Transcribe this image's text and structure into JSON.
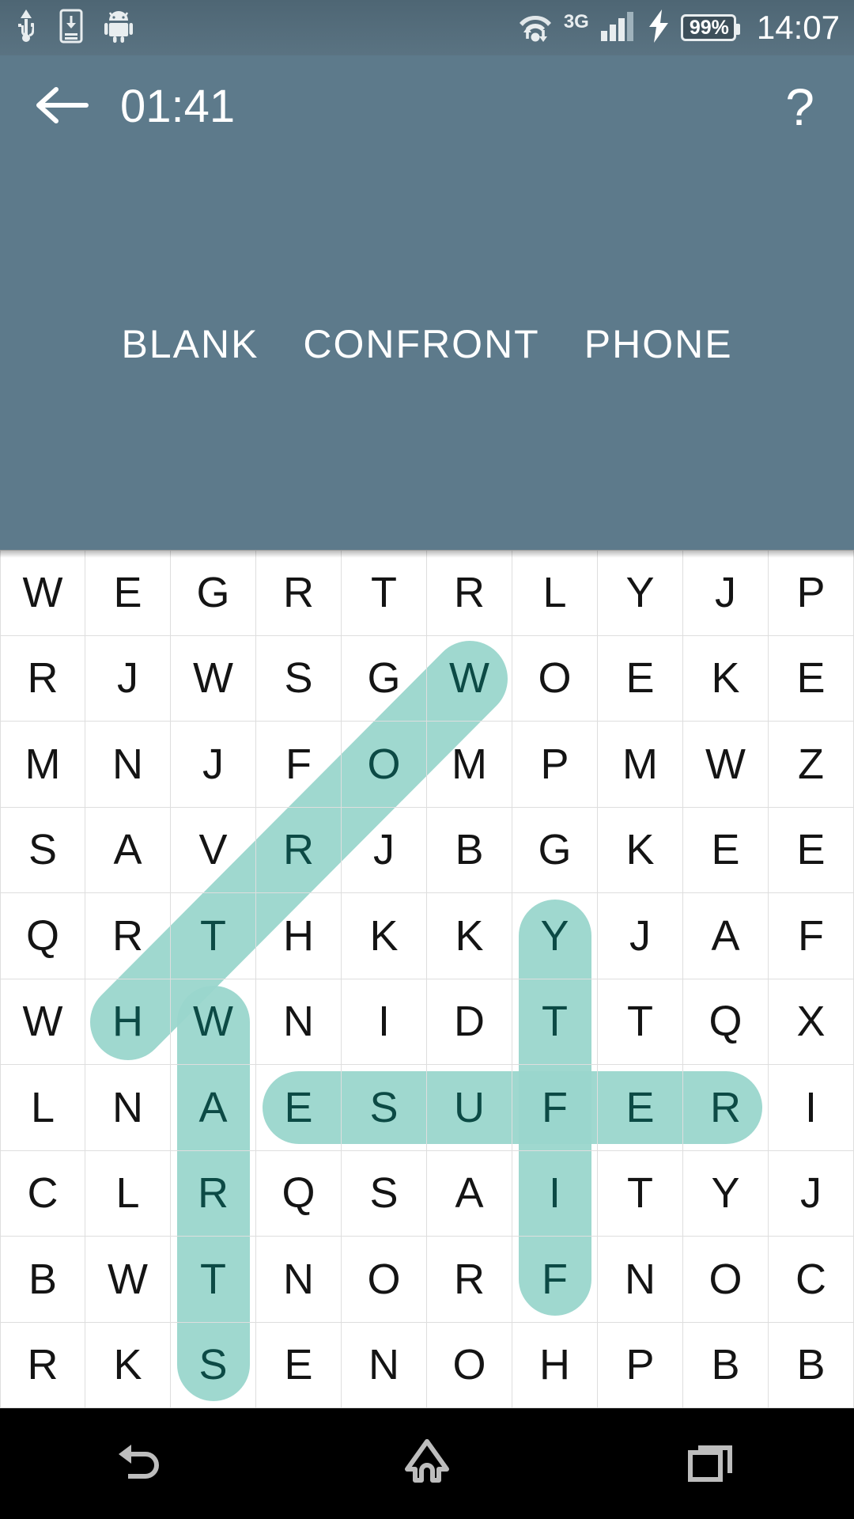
{
  "status_bar": {
    "icons": [
      "usb-icon",
      "sd-card-download-icon",
      "android-robot-icon"
    ],
    "network_label": "3G",
    "battery_percent": "99%",
    "clock": "14:07",
    "wifi_icon": "wifi-data-transfer-icon",
    "signal_icon": "cellular-signal-icon",
    "charging_icon": "lightning-bolt-icon"
  },
  "toolbar": {
    "back_icon": "back-arrow-icon",
    "timer": "01:41",
    "help_label": "?"
  },
  "word_list": {
    "words": [
      {
        "text": "BLANK",
        "found": false
      },
      {
        "text": "CONFRONT",
        "found": false
      },
      {
        "text": "PHONE",
        "found": false
      }
    ]
  },
  "colors": {
    "header_bg": "#5d7a8b",
    "status_bg": "#526b79",
    "grid_bg": "#ffffff",
    "grid_line": "#dedede",
    "letter": "#141414",
    "highlight": "#9ad6cd",
    "highlight_letter": "#0c4a45",
    "nav_bg": "#000000",
    "nav_icon": "#bdbdbd"
  },
  "grid": {
    "rows": 10,
    "cols": 10,
    "letters": [
      [
        "W",
        "E",
        "G",
        "R",
        "T",
        "R",
        "L",
        "Y",
        "J",
        "P"
      ],
      [
        "R",
        "J",
        "W",
        "S",
        "G",
        "W",
        "O",
        "E",
        "K",
        "E"
      ],
      [
        "M",
        "N",
        "J",
        "F",
        "O",
        "M",
        "P",
        "M",
        "W",
        "Z"
      ],
      [
        "S",
        "A",
        "V",
        "R",
        "J",
        "B",
        "G",
        "K",
        "E",
        "E"
      ],
      [
        "Q",
        "R",
        "T",
        "H",
        "K",
        "K",
        "Y",
        "J",
        "A",
        "F"
      ],
      [
        "W",
        "H",
        "W",
        "N",
        "I",
        "D",
        "T",
        "T",
        "Q",
        "X"
      ],
      [
        "L",
        "N",
        "A",
        "E",
        "S",
        "U",
        "F",
        "E",
        "R",
        "I"
      ],
      [
        "C",
        "L",
        "R",
        "Q",
        "S",
        "A",
        "I",
        "T",
        "Y",
        "J"
      ],
      [
        "B",
        "W",
        "T",
        "N",
        "O",
        "R",
        "F",
        "N",
        "O",
        "C"
      ],
      [
        "R",
        "K",
        "S",
        "E",
        "N",
        "O",
        "H",
        "P",
        "B",
        "B"
      ]
    ],
    "highlighted_cells": [
      [
        1,
        5
      ],
      [
        2,
        4
      ],
      [
        3,
        3
      ],
      [
        4,
        2
      ],
      [
        5,
        1
      ],
      [
        5,
        2
      ],
      [
        6,
        2
      ],
      [
        7,
        2
      ],
      [
        8,
        2
      ],
      [
        9,
        2
      ],
      [
        4,
        6
      ],
      [
        5,
        6
      ],
      [
        6,
        6
      ],
      [
        7,
        6
      ],
      [
        8,
        6
      ],
      [
        6,
        3
      ],
      [
        6,
        4
      ],
      [
        6,
        5
      ],
      [
        6,
        6
      ],
      [
        6,
        7
      ],
      [
        6,
        8
      ]
    ],
    "found_strokes": [
      {
        "name": "worth-diagonal",
        "word": "WORTH",
        "start": [
          1,
          5
        ],
        "end": [
          5,
          1
        ],
        "direction": "diagonal-down-left"
      },
      {
        "name": "warts-vertical",
        "word": "WARTS",
        "start": [
          5,
          2
        ],
        "end": [
          9,
          2
        ],
        "direction": "vertical-down"
      },
      {
        "name": "ytfif-vertical",
        "word": "YTFIF",
        "start": [
          4,
          6
        ],
        "end": [
          8,
          6
        ],
        "direction": "vertical-down"
      },
      {
        "name": "esufer-horizontal",
        "word": "ESUFER",
        "start": [
          6,
          3
        ],
        "end": [
          6,
          8
        ],
        "direction": "horizontal-right"
      }
    ]
  },
  "nav_bar": {
    "items": [
      {
        "name": "back-nav-button",
        "icon": "back-undo-icon"
      },
      {
        "name": "home-nav-button",
        "icon": "home-icon"
      },
      {
        "name": "recents-nav-button",
        "icon": "recent-apps-icon"
      }
    ]
  }
}
